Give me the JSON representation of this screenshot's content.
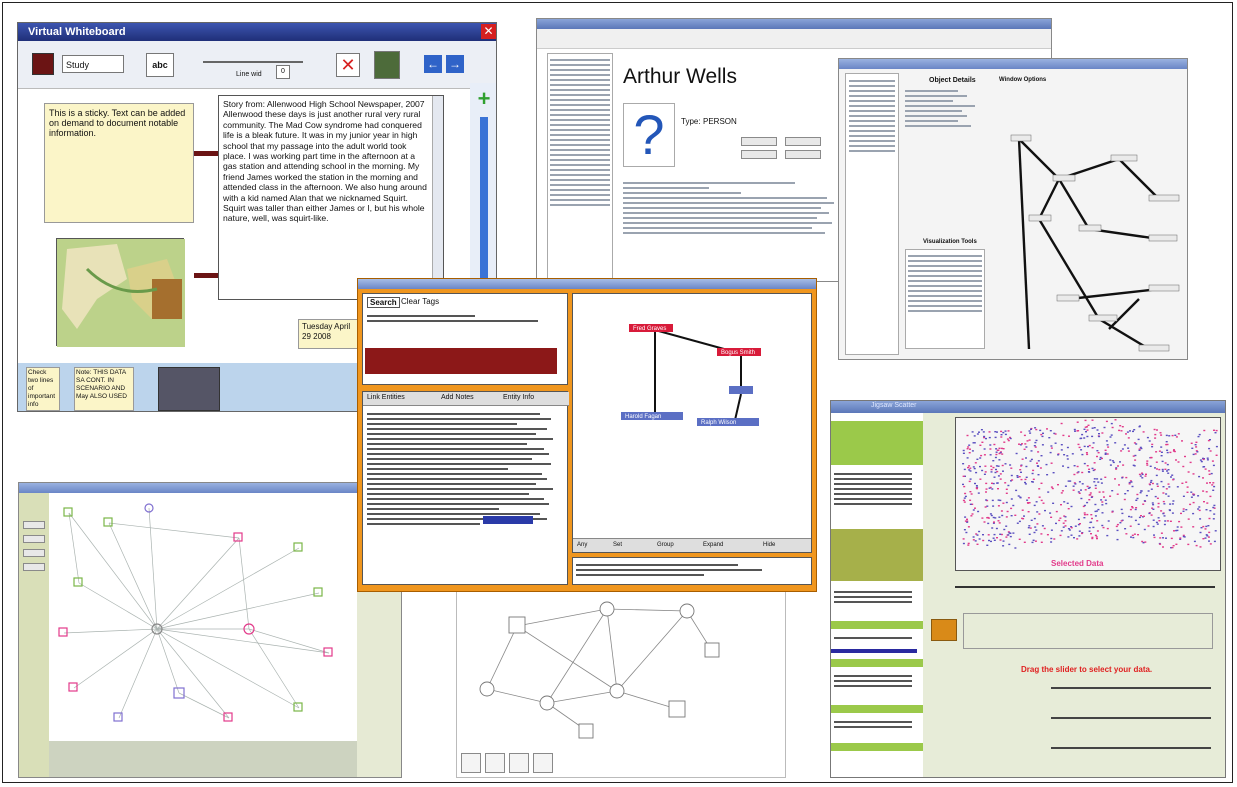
{
  "whiteboard": {
    "title": "Virtual Whiteboard",
    "font_select": "Study",
    "text_tool": "abc",
    "slider_label": "Line wid",
    "slider_value": "0",
    "sticky_note": "This is a sticky. Text can be added on demand to document notable information.",
    "story_text": "Story from: Allenwood High School Newspaper, 2007 Allenwood these days is just another rural very rural community. The Mad Cow syndrome had conquered life is a bleak future. It was in my junior year in high school that my passage into the adult world took place. I was working part time in the afternoon at a gas station and attending school in the morning. My friend James worked the station in the morning and attended class in the afternoon. We also hung around with a kid named Alan that we nicknamed Squirt. Squirt was taller than either James or I, but his whole nature, well, was squirt-like.",
    "date_note": "Tuesday April 29 2008",
    "bottom_note_1": "Check two lines of important info",
    "bottom_note_2": "Note: THIS DATA SA CONT. IN SCENARIO AND May ALSO USED"
  },
  "profile": {
    "name": "Arthur Wells",
    "type_label": "Type:",
    "type_value": "PERSON",
    "object_details_title": "Object Details",
    "visualization_title": "Visualization Tools",
    "window_options_title": "Window Options"
  },
  "center": {
    "search_tab": "Search",
    "clear_tab": "Clear Tags",
    "tabs": [
      "Link Entities",
      "Add Notes",
      "Entity Info"
    ],
    "node_top": "Fred Graves",
    "node_mid": "Bogus Smith",
    "node_bl": "Harold Fagan",
    "node_br": "Ralph Wilson",
    "bottom_items": [
      "Any",
      "Set",
      "Group",
      "Expand",
      "Hide"
    ]
  },
  "scatter": {
    "title": "Jigsaw Scatter",
    "selected_label": "Selected Data",
    "annotation": "Drag the slider to select your data."
  },
  "colors": {
    "whiteboard_title": "#2a3e8a",
    "close_red": "#d62020",
    "center_frame": "#f0961e",
    "node_red": "#d81b3a",
    "node_blue": "#5b6fc4",
    "scatter_pink": "#e23a8a",
    "scatter_purple": "#5a4fc0",
    "green_panel": "#9bc94a",
    "olive_panel": "#a6b04a"
  }
}
